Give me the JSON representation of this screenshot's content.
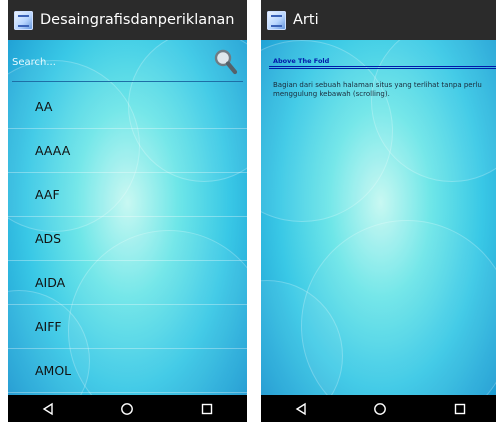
{
  "left_screen": {
    "title": "Desaingrafisdanperiklanan",
    "search": {
      "placeholder": "Search...",
      "value": ""
    },
    "items": [
      "AA",
      "AAAA",
      "AAF",
      "ADS",
      "AIDA",
      "AIFF",
      "AMOL"
    ]
  },
  "right_screen": {
    "title": "Arti",
    "term": "Above The Fold",
    "definition": "Bagian dari sebuah halaman situs yang terlihat tanpa perlu menggulung kebawah (scrolling)."
  },
  "navigation": [
    "back",
    "home",
    "recents"
  ],
  "colors": {
    "titlebar": "#2b2b2b",
    "navbar": "#000000",
    "term_color": "#001aa8",
    "underline": "#1e6fa6"
  }
}
